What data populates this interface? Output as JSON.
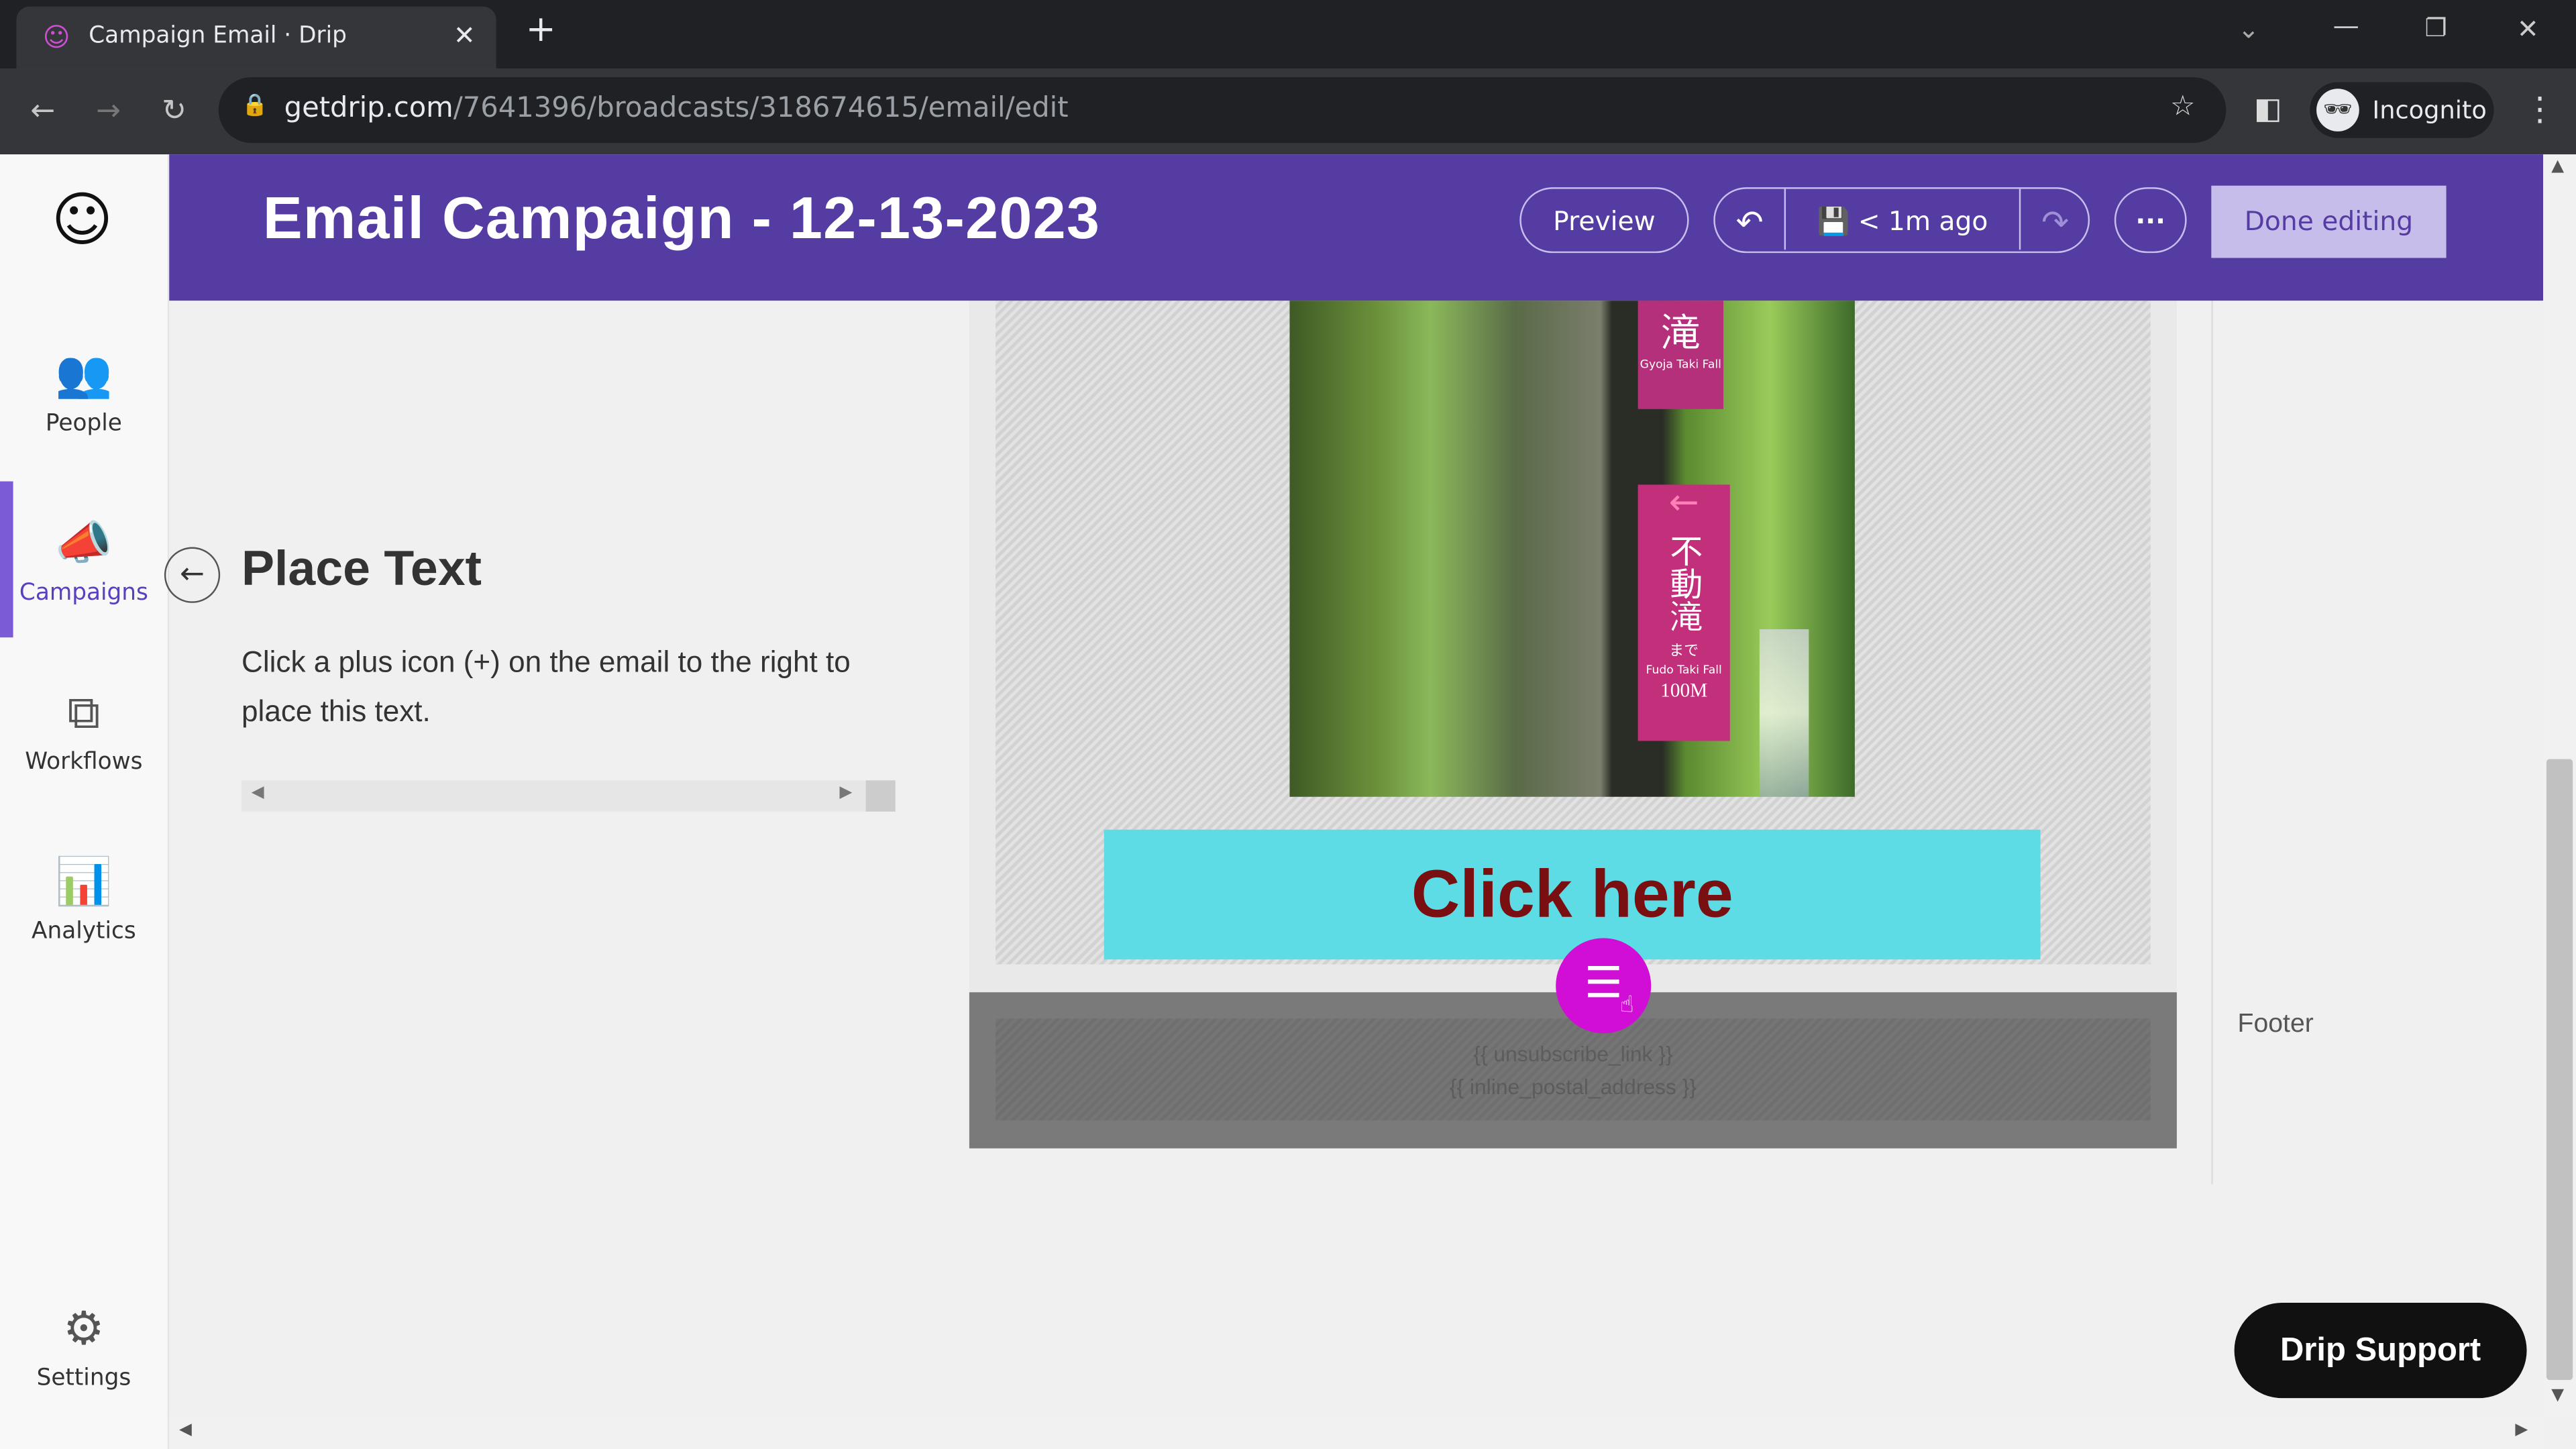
{
  "browser": {
    "tab_title": "Campaign Email · Drip",
    "url_domain": "getdrip.com",
    "url_path": "/7641396/broadcasts/318674615/email/edit",
    "profile_label": "Incognito"
  },
  "sidebar": {
    "items": [
      {
        "label": "People",
        "icon": "people-icon"
      },
      {
        "label": "Campaigns",
        "icon": "megaphone-icon",
        "active": true
      },
      {
        "label": "Workflows",
        "icon": "workflow-icon"
      },
      {
        "label": "Analytics",
        "icon": "bar-chart-icon"
      },
      {
        "label": "Settings",
        "icon": "gear-icon"
      }
    ]
  },
  "header": {
    "title": "Email Campaign - 12-13-2023",
    "preview_label": "Preview",
    "save_status": "< 1m ago",
    "done_label": "Done editing",
    "color": "#553ca3"
  },
  "panel": {
    "title": "Place Text",
    "instruction": "Click a plus icon (+) on the email to the right to place this text."
  },
  "email": {
    "photo_sign_top": "滝",
    "photo_sign_top_caption": "Gyoja Taki Fall",
    "photo_sign_main": "不動滝",
    "photo_sign_small": "まで",
    "photo_sign_caption": "Fudo Taki Fall",
    "photo_sign_distance": "100M",
    "button_label": "Click here",
    "button_color": "#5ddce5",
    "footer_line1": "{{ unsubscribe_link }}",
    "footer_line2": "{{ inline_postal_address }}"
  },
  "right_panel": {
    "footer_label": "Footer"
  },
  "support_label": "Drip Support"
}
